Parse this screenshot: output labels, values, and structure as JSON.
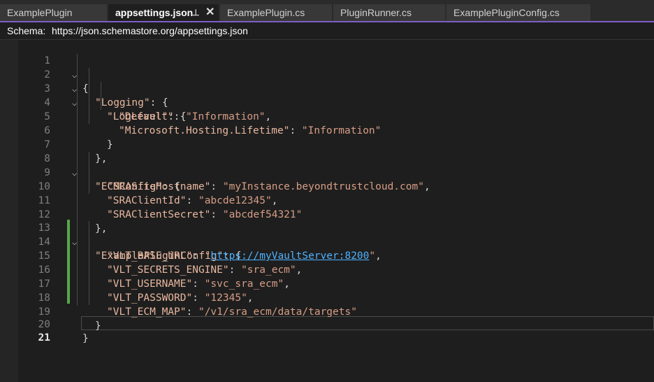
{
  "tabs": [
    {
      "label": "ExamplePlugin",
      "active": false
    },
    {
      "label": "appsettings.json",
      "active": true
    },
    {
      "label": "ExamplePlugin.cs",
      "active": false
    },
    {
      "label": "PluginRunner.cs",
      "active": false
    },
    {
      "label": "ExamplePluginConfig.cs",
      "active": false
    }
  ],
  "tab_icons": {
    "pin": "⊥",
    "close": "✕"
  },
  "schema": {
    "label": "Schema:",
    "url": "https://json.schemastore.org/appsettings.json"
  },
  "editor": {
    "line_numbers": [
      "1",
      "2",
      "3",
      "4",
      "5",
      "6",
      "7",
      "8",
      "9",
      "10",
      "11",
      "12",
      "13",
      "14",
      "15",
      "16",
      "17",
      "18",
      "19",
      "20",
      "21"
    ],
    "current_line": "21",
    "code": {
      "l1": "{",
      "l2_key": "\"Logging\"",
      "l2_rest": ": {",
      "l3_key": "\"LogLevel\"",
      "l3_rest": ": {",
      "l4_key": "\"Default\"",
      "l4_sep": ": ",
      "l4_val": "\"Information\"",
      "l4_end": ",",
      "l5_key": "\"Microsoft.Hosting.Lifetime\"",
      "l5_sep": ": ",
      "l5_val": "\"Information\"",
      "l6": "}",
      "l7": "},",
      "l8_key": "\"ECMConfig\"",
      "l8_rest": ": {",
      "l9_key": "\"SRASiteHostname\"",
      "l9_sep": ": ",
      "l9_val": "\"myInstance.beyondtrustcloud.com\"",
      "l9_end": ",",
      "l10_key": "\"SRAClientId\"",
      "l10_sep": ": ",
      "l10_val": "\"abcde12345\"",
      "l10_end": ",",
      "l11_key": "\"SRAClientSecret\"",
      "l11_sep": ": ",
      "l11_val": "\"abcdef54321\"",
      "l12": "},",
      "l13_key": "\"ExamplePluginConfig\"",
      "l13_rest": ": {",
      "l14_key": "\"VLT_BASE_URL\"",
      "l14_sep": ": ",
      "l14_q1": "\"",
      "l14_link": "https://myVaultServer:8200",
      "l14_q2": "\"",
      "l14_end": ",",
      "l15_key": "\"VLT_SECRETS_ENGINE\"",
      "l15_sep": ": ",
      "l15_val": "\"sra_ecm\"",
      "l15_end": ",",
      "l16_key": "\"VLT_USERNAME\"",
      "l16_sep": ": ",
      "l16_val": "\"svc_sra_ecm\"",
      "l16_end": ",",
      "l17_key": "\"VLT_PASSWORD\"",
      "l17_sep": ": ",
      "l17_val": "\"12345\"",
      "l17_end": ",",
      "l18_key": "\"VLT_ECM_MAP\"",
      "l18_sep": ": ",
      "l18_val": "\"/v1/sra_ecm/data/targets\"",
      "l19": "}",
      "l20": "}"
    },
    "fold_icon": "⌵"
  }
}
